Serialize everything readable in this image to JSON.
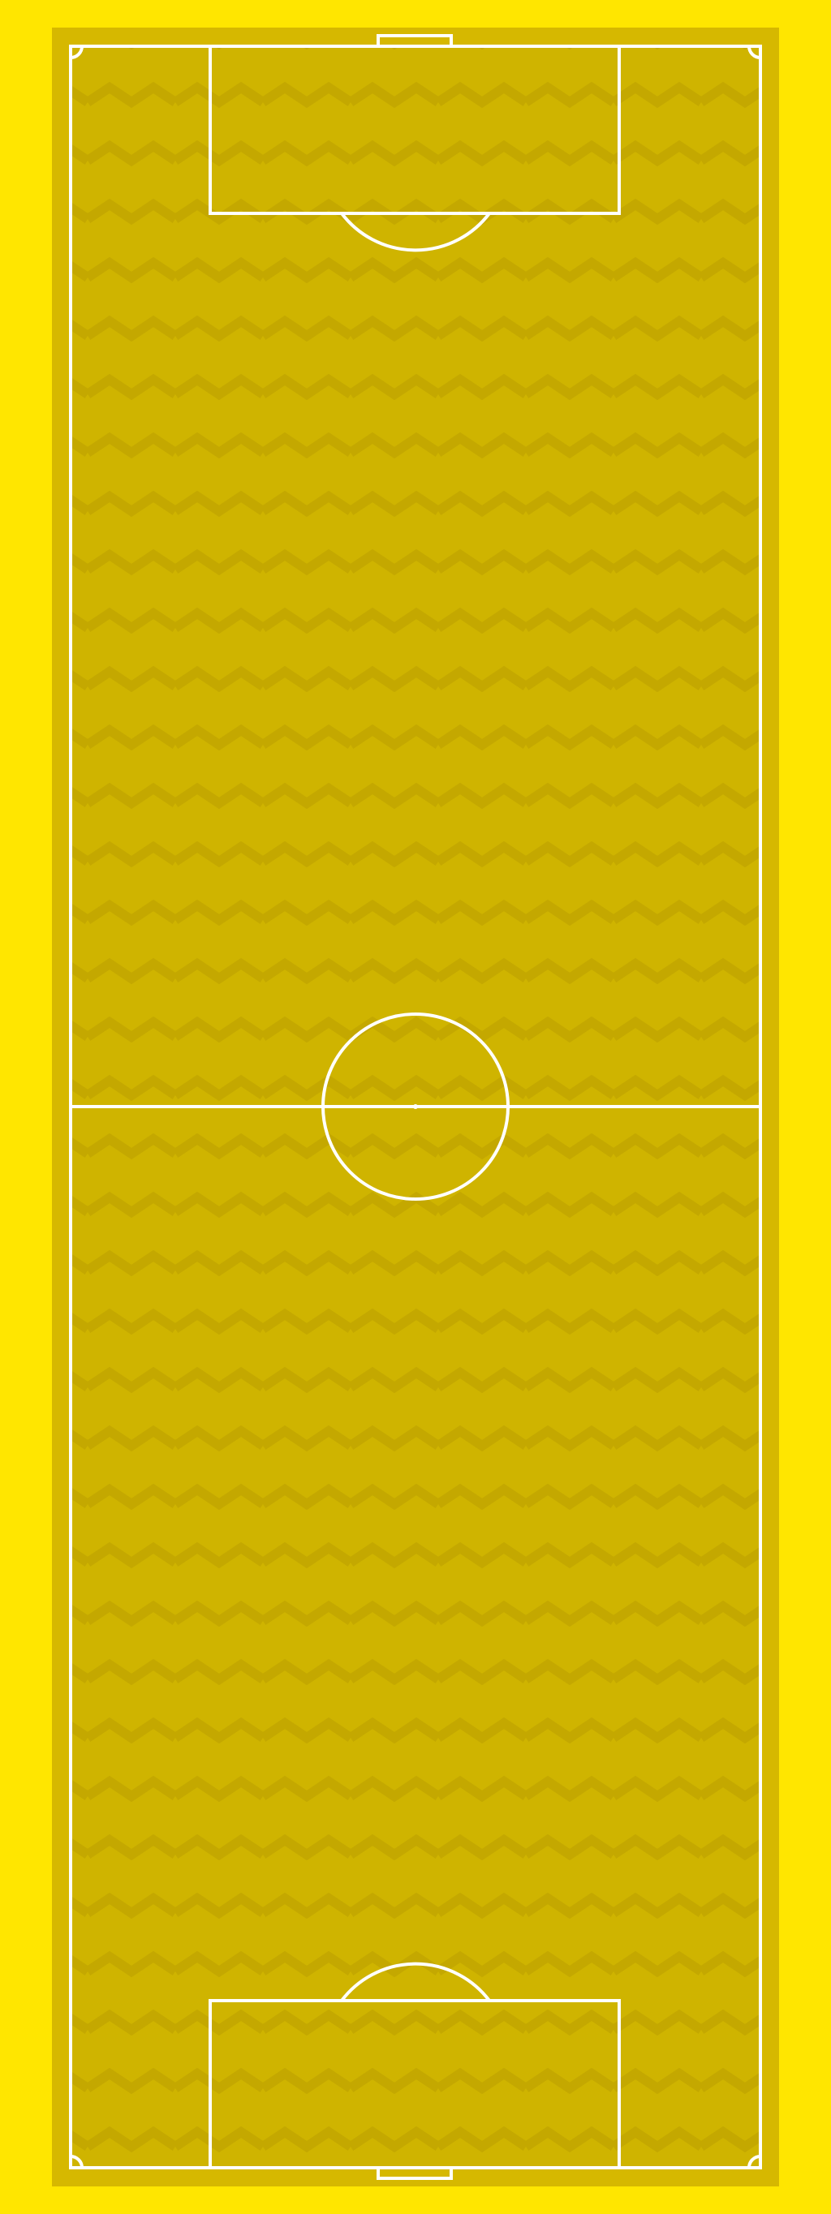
{
  "pitch": {
    "kind": "football-pitch",
    "orientation": "vertical",
    "colors": {
      "frame": "#FFE600",
      "surround": "#D6B800",
      "turf": "#CFB400",
      "zigzag": "#C4A800",
      "lines": "#FFFFFF"
    },
    "markings": [
      "touchlines",
      "goal-lines",
      "halfway-line",
      "centre-circle",
      "centre-spot",
      "penalty-area-top",
      "penalty-area-bottom",
      "penalty-arc-top",
      "penalty-arc-bottom",
      "goal-top",
      "goal-bottom",
      "corner-arcs"
    ]
  }
}
